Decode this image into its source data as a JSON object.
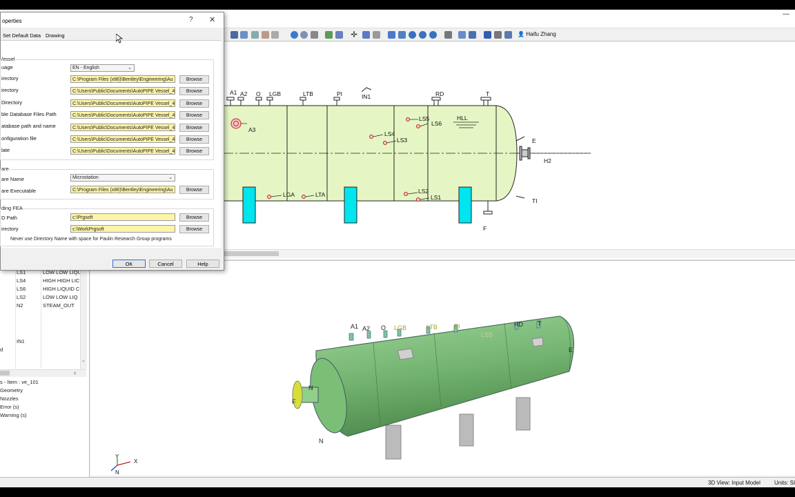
{
  "toolbar": {
    "user_name": "Haifu Zhang"
  },
  "dialog": {
    "title": "operties",
    "tabs": [
      "Set Default Data",
      "Drawing"
    ],
    "help_glyph": "?",
    "close_glyph": "✕",
    "section_vessel": "/essel",
    "language_label": "uage",
    "language_value": "EN - English",
    "fields": [
      {
        "label": "irectory",
        "value": "C:\\Program Files (x86)\\Bentley\\Engineering\\Au"
      },
      {
        "label": "irectory",
        "value": "C:\\Users\\Public\\Documents\\AutoPIPE Vessel_4"
      },
      {
        "label": "Directory",
        "value": "C:\\Users\\Public\\Documents\\AutoPIPE Vessel_4"
      },
      {
        "label": "ble Database Files Path",
        "value": "C:\\Users\\Public\\Documents\\AutoPIPE Vessel_4"
      },
      {
        "label": "atabase path and name",
        "value": "C:\\Users\\Public\\Documents\\AutoPIPE Vessel_4"
      },
      {
        "label": "onfiguration file",
        "value": "C:\\Users\\Public\\Documents\\AutoPIPE Vessel_4"
      },
      {
        "label": "late",
        "value": "C:\\Users\\Public\\Documents\\AutoPIPE Vessel_4"
      }
    ],
    "section_cad": "are",
    "cad_name_label": "are Name",
    "cad_name_value": "Microstation",
    "cad_exe_label": "are Executable",
    "cad_exe_value": "C:\\Program Files (x86)\\Bentley\\Engineering\\Au",
    "section_fea": "ding FEA",
    "fea_fields": [
      {
        "label": "D Path",
        "value": "c:\\Prgsoft"
      },
      {
        "label": "irectory",
        "value": "c:\\WorkPrgsoft"
      }
    ],
    "browse_label": "Browse",
    "note": "Never use Directory Name with space for Paulin Research Group programs",
    "ok_label": "OK",
    "cancel_label": "Cancel",
    "help_label": "Help"
  },
  "drawing2d": {
    "nozzle_labels": [
      "A1",
      "A2",
      "O",
      "LGB",
      "LTB",
      "PI",
      "IN1",
      "RD",
      "T"
    ],
    "internal_labels": [
      "A3",
      "LS5",
      "LS6",
      "HLL",
      "LS4",
      "LS3",
      "LGA",
      "LTA",
      "LS2",
      "LS1"
    ],
    "right_labels": [
      "E",
      "H2",
      "TI",
      "F"
    ]
  },
  "nozzle_table": {
    "rows": [
      {
        "id": "LS1",
        "desc": "LOW LOW LIQU"
      },
      {
        "id": "LS4",
        "desc": "HIGH HIGH LIC"
      },
      {
        "id": "LS6",
        "desc": "HIGH LIQUID C"
      },
      {
        "id": "LS2",
        "desc": "LOW LOW LIQ"
      },
      {
        "id": "N2",
        "desc": "STEAM_OUT"
      },
      {
        "id": "",
        "desc": ""
      },
      {
        "id": "",
        "desc": ""
      },
      {
        "id": "",
        "desc": ""
      },
      {
        "id": "IN1",
        "desc": ""
      },
      {
        "id": "",
        "desc": ""
      }
    ],
    "row_tail_label": "d",
    "scroll_arrow": "›"
  },
  "messages": [
    "s - Item : ve_101",
    "Geometry",
    "Nozzles",
    "Error (s)",
    "Warning (s)"
  ],
  "view3d": {
    "labels": [
      "A1",
      "A2",
      "O",
      "LGB",
      "LTB",
      "PI",
      "LSS",
      "RD",
      "T",
      "E",
      "N",
      "F",
      "N"
    ],
    "axis_labels": [
      "Y",
      "X",
      "N"
    ]
  },
  "status": {
    "view_mode": "3D View: Input Model",
    "units": "Units: SI"
  },
  "colors": {
    "vessel_fill": "#e5f6c4",
    "saddle_fill": "#00e5ee",
    "nozzle_marker": "#c02020",
    "highlight_field": "#fcf4a8",
    "vessel_3d": "#6cad6a"
  }
}
